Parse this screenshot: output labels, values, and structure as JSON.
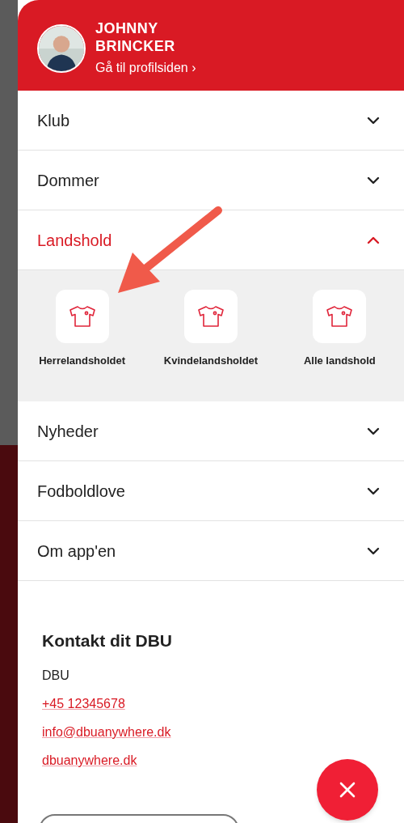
{
  "profile": {
    "name": "JOHNNY BRINCKER",
    "link": "Gå til profilsiden ›"
  },
  "menu": [
    {
      "label": "Klub",
      "expanded": false
    },
    {
      "label": "Dommer",
      "expanded": false
    },
    {
      "label": "Landshold",
      "expanded": true,
      "tiles": [
        {
          "label": "Herrelandsholdet"
        },
        {
          "label": "Kvindelandsholdet"
        },
        {
          "label": "Alle landshold"
        }
      ]
    },
    {
      "label": "Nyheder",
      "expanded": false
    },
    {
      "label": "Fodboldlove",
      "expanded": false
    },
    {
      "label": "Om app'en",
      "expanded": false
    }
  ],
  "contact": {
    "title": "Kontakt dit DBU",
    "org": "DBU",
    "links": [
      "+45 12345678",
      "info@dbuanywhere.dk",
      "dbuanywhere.dk"
    ]
  }
}
